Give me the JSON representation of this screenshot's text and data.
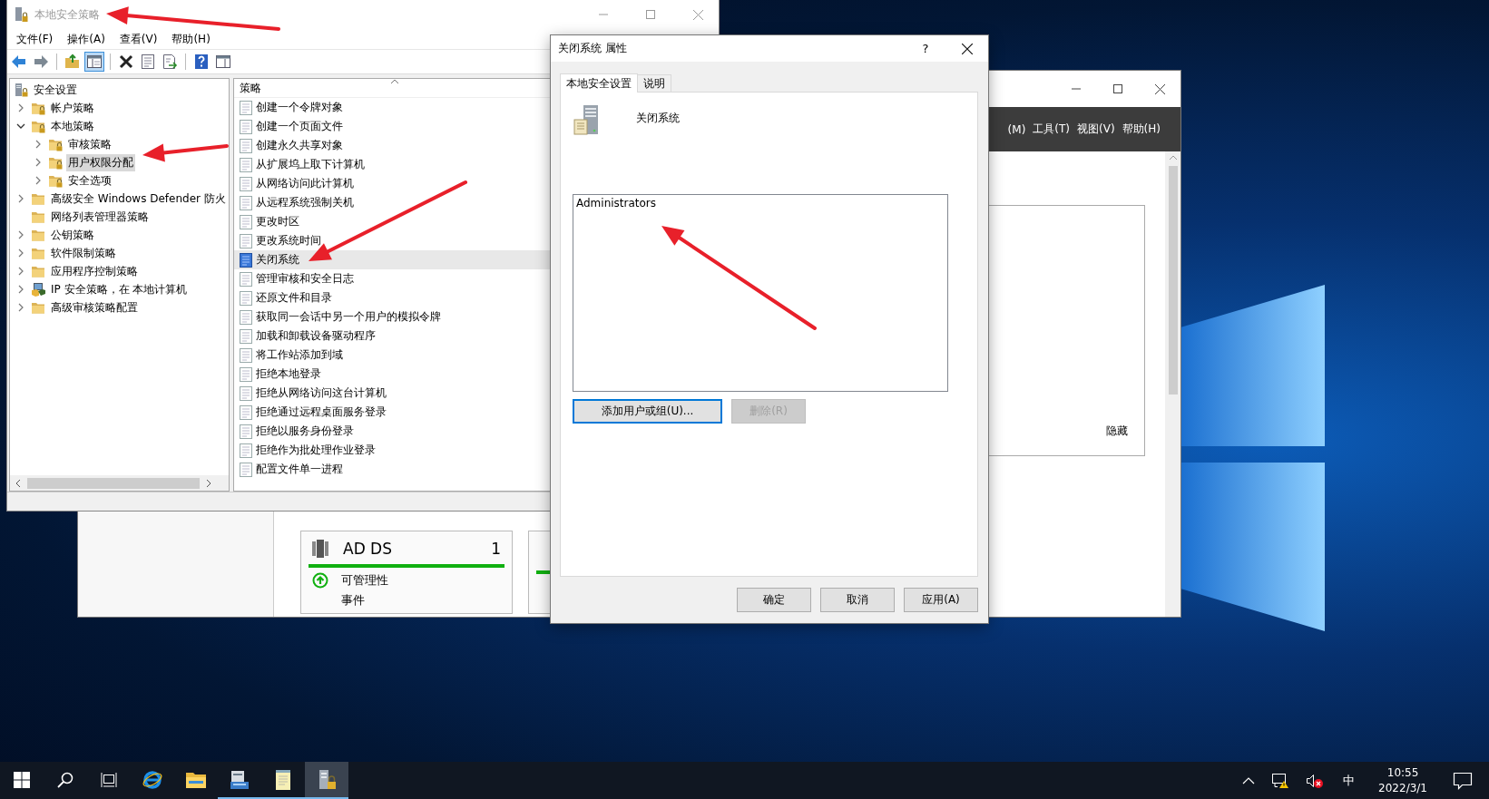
{
  "security_policy_window": {
    "title": "本地安全策略",
    "active": false,
    "menu": [
      "文件(F)",
      "操作(A)",
      "查看(V)",
      "帮助(H)"
    ],
    "toolbar": [
      {
        "kind": "back",
        "pressed": false
      },
      {
        "kind": "forward",
        "pressed": false
      },
      {
        "kind": "separator"
      },
      {
        "kind": "up-folder",
        "pressed": false
      },
      {
        "kind": "tree-toggle",
        "pressed": true
      },
      {
        "kind": "separator"
      },
      {
        "kind": "delete",
        "pressed": false
      },
      {
        "kind": "properties",
        "pressed": false
      },
      {
        "kind": "export",
        "pressed": false
      },
      {
        "kind": "separator"
      },
      {
        "kind": "help",
        "pressed": false
      },
      {
        "kind": "view",
        "pressed": false
      }
    ],
    "tree": [
      {
        "label": "安全设置",
        "kind": "computer-lock",
        "selected": false,
        "children": [
          {
            "label": "帐户策略",
            "kind": "folder-lock",
            "expanded": false,
            "selected": false
          },
          {
            "label": "本地策略",
            "kind": "folder-lock",
            "expanded": true,
            "selected": false,
            "children": [
              {
                "label": "审核策略",
                "kind": "folder-lock",
                "expanded": false,
                "selected": false
              },
              {
                "label": "用户权限分配",
                "kind": "folder-lock",
                "expanded": false,
                "selected": true
              },
              {
                "label": "安全选项",
                "kind": "folder-lock",
                "expanded": false,
                "selected": false
              }
            ]
          },
          {
            "label": "高级安全 Windows Defender 防火",
            "kind": "folder",
            "expanded": false,
            "selected": false
          },
          {
            "label": "网络列表管理器策略",
            "kind": "folder",
            "selected": false
          },
          {
            "label": "公钥策略",
            "kind": "folder",
            "expanded": false,
            "selected": false
          },
          {
            "label": "软件限制策略",
            "kind": "folder",
            "expanded": false,
            "selected": false
          },
          {
            "label": "应用程序控制策略",
            "kind": "folder",
            "expanded": false,
            "selected": false
          },
          {
            "label": "IP 安全策略，在 本地计算机",
            "kind": "computer-shield",
            "expanded": false,
            "selected": false
          },
          {
            "label": "高级审核策略配置",
            "kind": "folder",
            "expanded": false,
            "selected": false
          }
        ]
      }
    ],
    "list_header": "策略",
    "policies": [
      {
        "label": "创建一个令牌对象",
        "selected": false
      },
      {
        "label": "创建一个页面文件",
        "selected": false
      },
      {
        "label": "创建永久共享对象",
        "selected": false
      },
      {
        "label": "从扩展坞上取下计算机",
        "selected": false
      },
      {
        "label": "从网络访问此计算机",
        "selected": false
      },
      {
        "label": "从远程系统强制关机",
        "selected": false
      },
      {
        "label": "更改时区",
        "selected": false
      },
      {
        "label": "更改系统时间",
        "selected": false
      },
      {
        "label": "关闭系统",
        "selected": true
      },
      {
        "label": "管理审核和安全日志",
        "selected": false
      },
      {
        "label": "还原文件和目录",
        "selected": false
      },
      {
        "label": "获取同一会话中另一个用户的模拟令牌",
        "selected": false
      },
      {
        "label": "加载和卸载设备驱动程序",
        "selected": false
      },
      {
        "label": "将工作站添加到域",
        "selected": false
      },
      {
        "label": "拒绝本地登录",
        "selected": false
      },
      {
        "label": "拒绝从网络访问这台计算机",
        "selected": false
      },
      {
        "label": "拒绝通过远程桌面服务登录",
        "selected": false
      },
      {
        "label": "拒绝以服务身份登录",
        "selected": false
      },
      {
        "label": "拒绝作为批处理作业登录",
        "selected": false
      },
      {
        "label": "配置文件单一进程",
        "selected": false
      }
    ]
  },
  "properties_dialog": {
    "title": "关闭系统 属性",
    "help": "?",
    "tabs": [
      {
        "label": "本地安全设置",
        "selected": true
      },
      {
        "label": "说明",
        "selected": false
      }
    ],
    "policy_name": "关闭系统",
    "members": [
      "Administrators"
    ],
    "add_button": {
      "label": "添加用户或组(U)...",
      "disabled": false
    },
    "remove_button": {
      "label": "删除(R)",
      "disabled": true
    },
    "footer_buttons": [
      {
        "label": "确定"
      },
      {
        "label": "取消"
      },
      {
        "label": "应用(A)"
      }
    ]
  },
  "server_manager_window": {
    "menu": [
      "(M)",
      "工具(T)",
      "视图(V)",
      "帮助(H)"
    ],
    "hide_link": "隐藏",
    "cards": [
      {
        "title": "AD DS",
        "count": "1",
        "rows": [
          "可管理性",
          "事件"
        ]
      }
    ]
  },
  "taskbar": {
    "items": [
      {
        "kind": "start",
        "running": false,
        "selected": false
      },
      {
        "kind": "search",
        "running": false,
        "selected": false
      },
      {
        "kind": "task-view",
        "running": false,
        "selected": false
      },
      {
        "kind": "browser",
        "running": false,
        "selected": false
      },
      {
        "kind": "folder",
        "running": false,
        "selected": false
      },
      {
        "kind": "server-manager",
        "running": true,
        "selected": false
      },
      {
        "kind": "notepad",
        "running": true,
        "selected": false
      },
      {
        "kind": "policy",
        "running": true,
        "selected": true
      }
    ],
    "ime": "中",
    "time": "10:55",
    "date": "2022/3/1"
  }
}
